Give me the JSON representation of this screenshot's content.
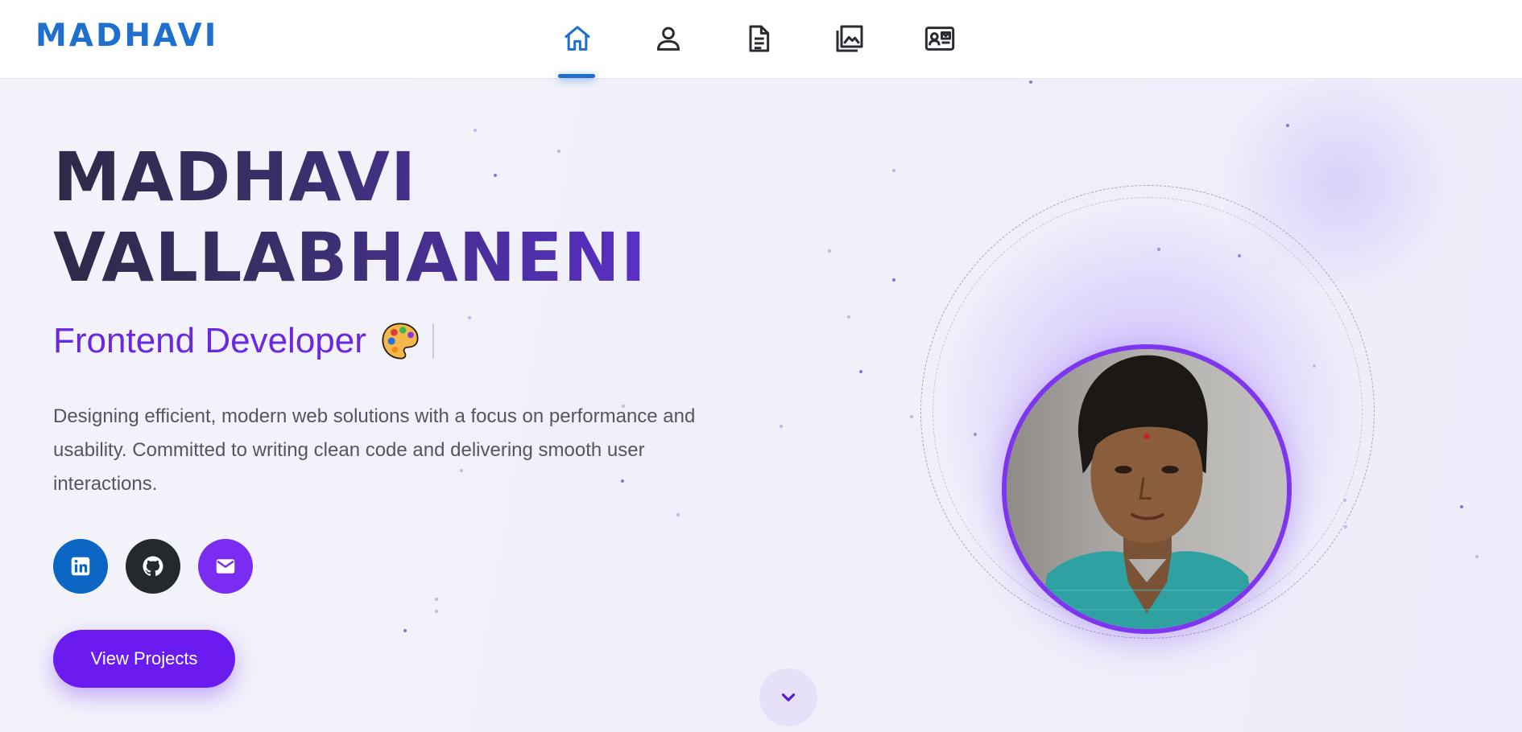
{
  "navbar": {
    "logo": "MADHAVI",
    "items": [
      {
        "name": "home",
        "icon": "home-icon",
        "active": true
      },
      {
        "name": "about",
        "icon": "user-icon",
        "active": false
      },
      {
        "name": "resume",
        "icon": "document-icon",
        "active": false
      },
      {
        "name": "projects",
        "icon": "gallery-icon",
        "active": false
      },
      {
        "name": "contact",
        "icon": "contact-card-icon",
        "active": false
      }
    ],
    "active_color": "#1f6fce"
  },
  "hero": {
    "name_line1": "MADHAVI",
    "name_line2": "VALLABHANENI",
    "role": "Frontend Developer",
    "role_emoji_icon": "artist-palette-icon",
    "description": "Designing efficient, modern web solutions with a focus on performance and usability. Committed to writing clean code and delivering smooth user interactions.",
    "social": [
      {
        "name": "linkedin",
        "icon": "linkedin-icon",
        "color": "#0a66c2"
      },
      {
        "name": "github",
        "icon": "github-icon",
        "color": "#24292e"
      },
      {
        "name": "email",
        "icon": "mail-icon",
        "color": "#7a2cf0"
      }
    ],
    "cta_label": "View Projects",
    "scroll_icon": "chevron-down-icon",
    "accent": "#6a1cf0"
  }
}
